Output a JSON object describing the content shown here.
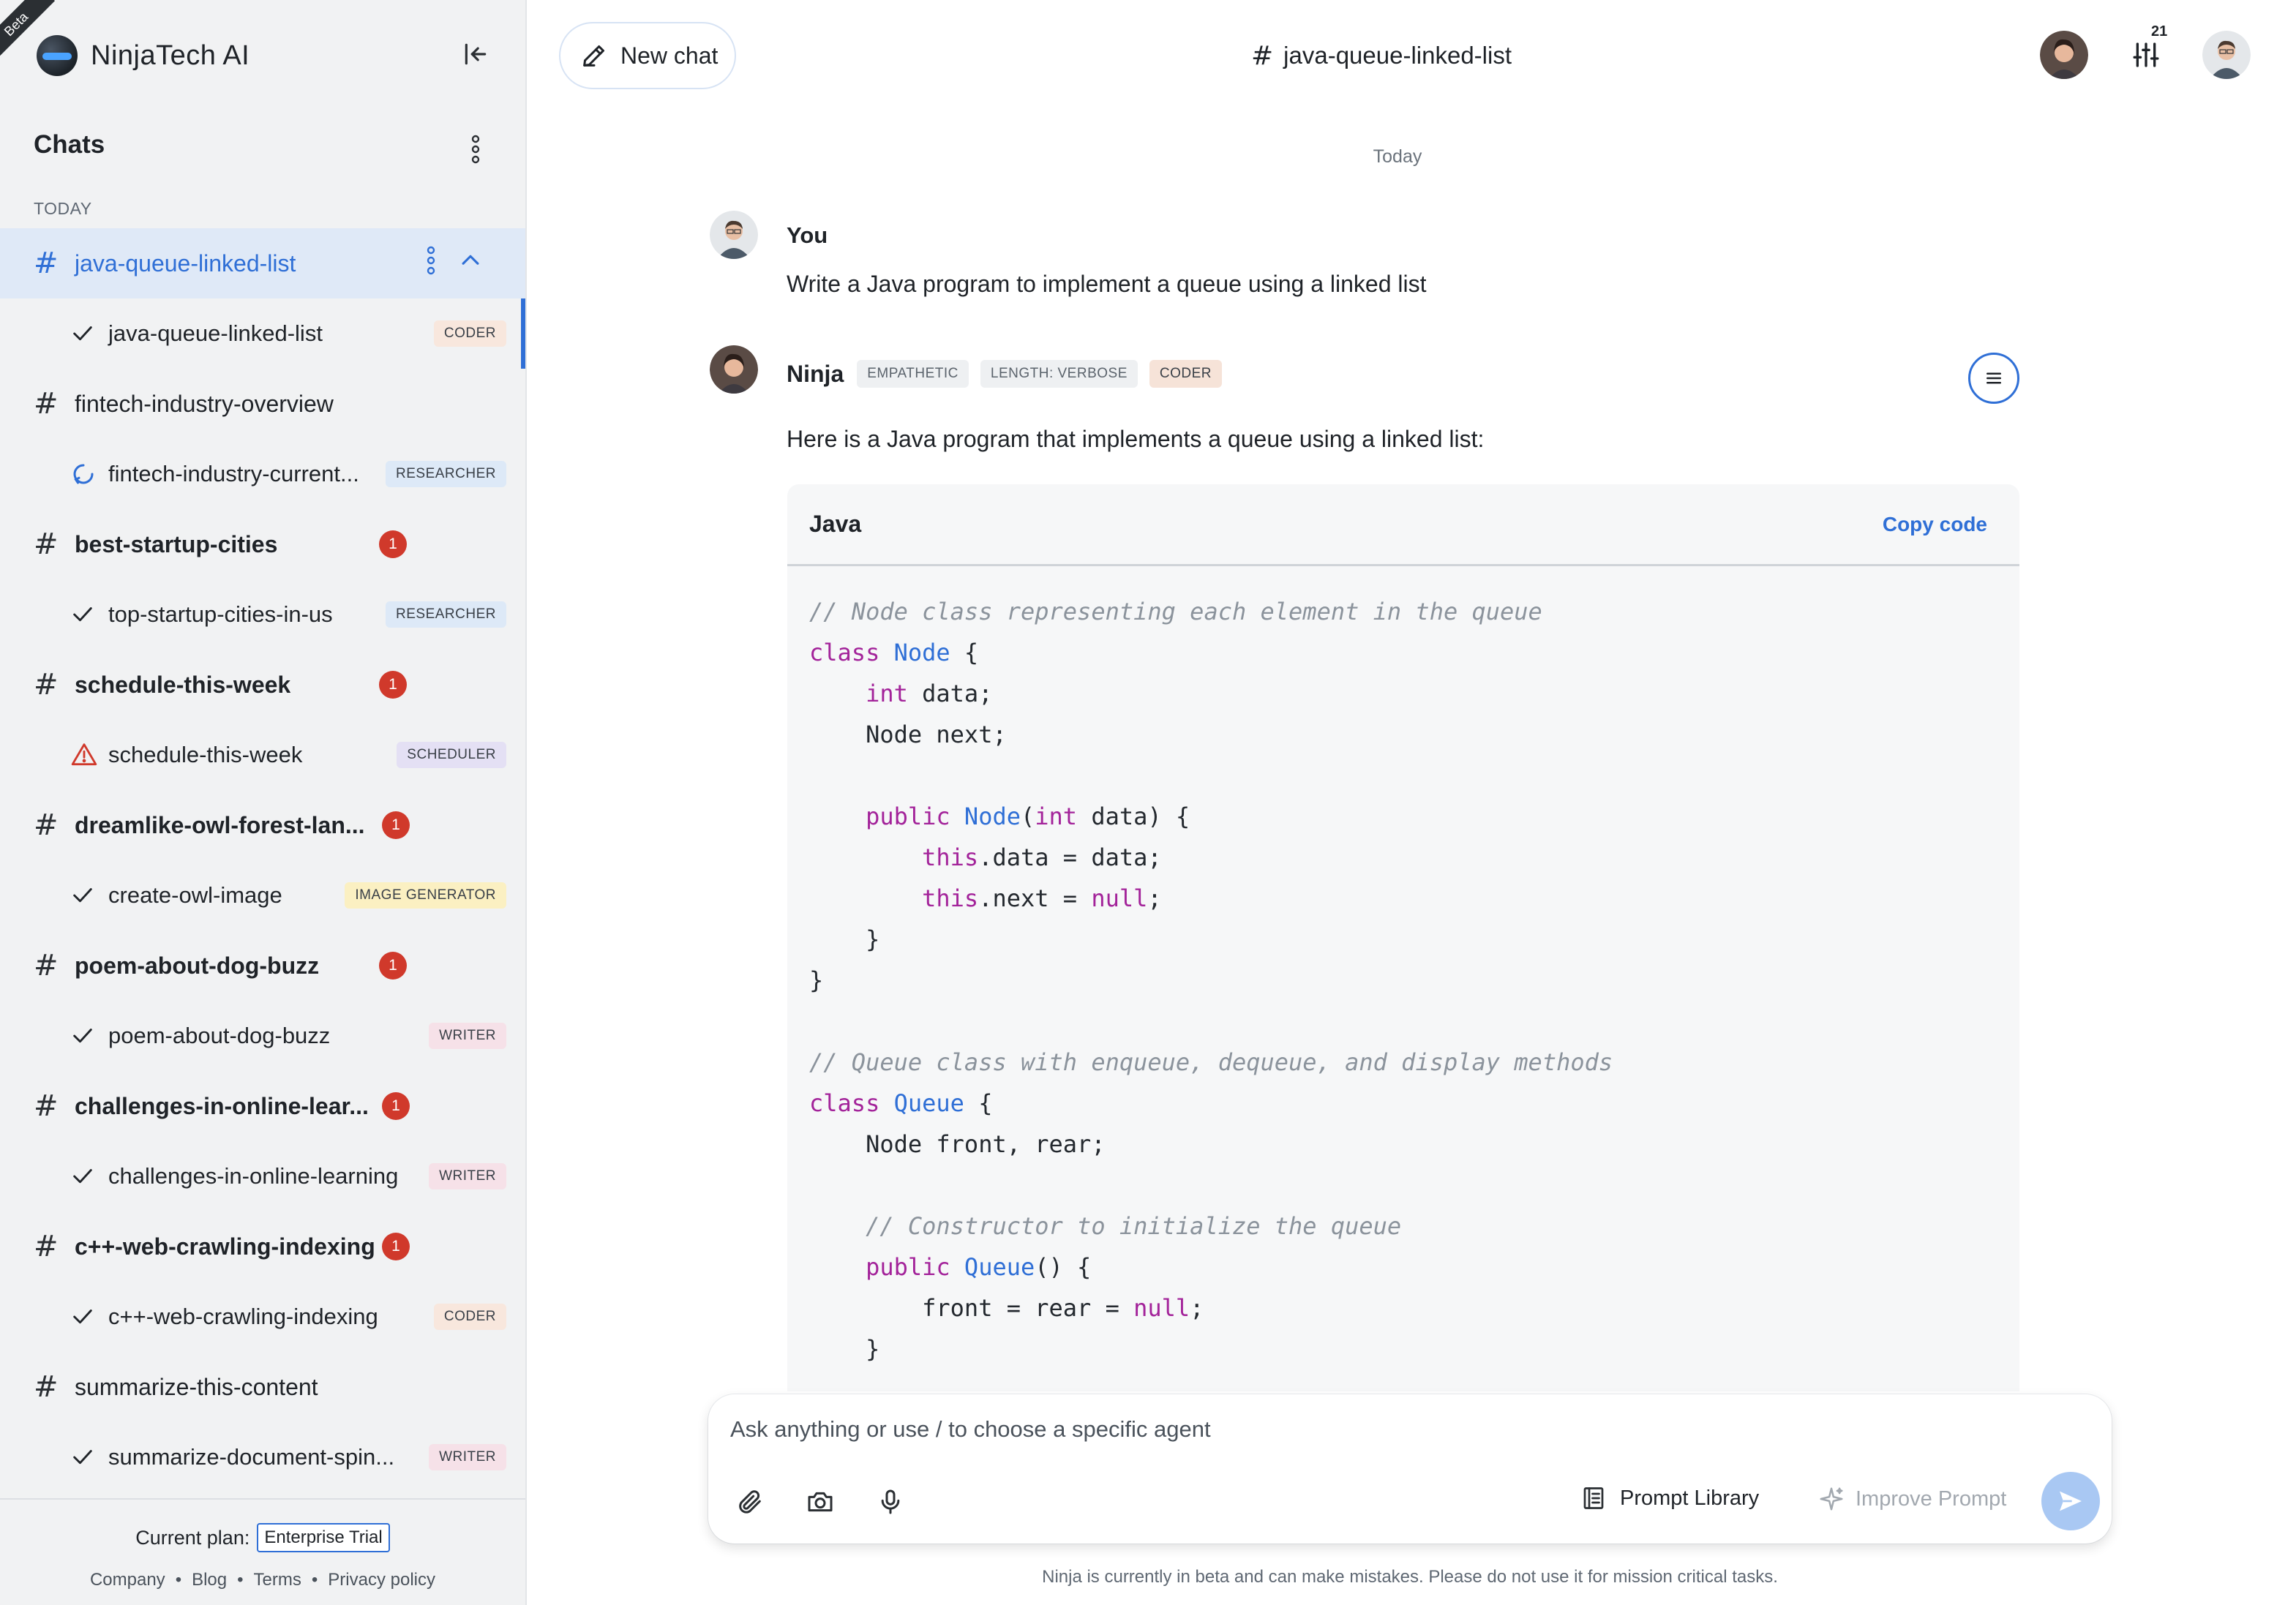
{
  "beta_ribbon": "Beta",
  "brand": {
    "name": "NinjaTech AI"
  },
  "sidebar": {
    "chats_title": "Chats",
    "section_label": "TODAY",
    "threads": [
      {
        "name": "java-queue-linked-list",
        "active": true,
        "bold": false,
        "unread": "",
        "task": {
          "name": "java-queue-linked-list",
          "status": "done",
          "agent": "CODER"
        }
      },
      {
        "name": "fintech-industry-overview",
        "active": false,
        "bold": false,
        "unread": "",
        "task": {
          "name": "fintech-industry-current...",
          "status": "in-progress",
          "agent": "RESEARCHER"
        }
      },
      {
        "name": "best-startup-cities",
        "active": false,
        "bold": true,
        "unread": "1",
        "task": {
          "name": "top-startup-cities-in-us",
          "status": "done",
          "agent": "RESEARCHER"
        }
      },
      {
        "name": "schedule-this-week",
        "active": false,
        "bold": true,
        "unread": "1",
        "task": {
          "name": "schedule-this-week",
          "status": "warning",
          "agent": "SCHEDULER"
        }
      },
      {
        "name": "dreamlike-owl-forest-lan...",
        "active": false,
        "bold": true,
        "unread": "1",
        "task": {
          "name": "create-owl-image",
          "status": "done",
          "agent": "IMAGE GENERATOR"
        }
      },
      {
        "name": "poem-about-dog-buzz",
        "active": false,
        "bold": true,
        "unread": "1",
        "task": {
          "name": "poem-about-dog-buzz",
          "status": "done",
          "agent": "WRITER"
        }
      },
      {
        "name": "challenges-in-online-lear...",
        "active": false,
        "bold": true,
        "unread": "1",
        "task": {
          "name": "challenges-in-online-learning",
          "status": "done",
          "agent": "WRITER"
        }
      },
      {
        "name": "c++-web-crawling-indexing",
        "active": false,
        "bold": true,
        "unread": "1",
        "task": {
          "name": "c++-web-crawling-indexing",
          "status": "done",
          "agent": "CODER"
        }
      },
      {
        "name": "summarize-this-content",
        "active": false,
        "bold": false,
        "unread": "",
        "task": {
          "name": "summarize-document-spin...",
          "status": "done",
          "agent": "WRITER"
        }
      }
    ],
    "footer": {
      "plan_label": "Current plan:",
      "plan_value": "Enterprise Trial",
      "links": [
        "Company",
        "Blog",
        "Terms",
        "Privacy policy"
      ]
    }
  },
  "header": {
    "new_chat_label": "New chat",
    "chat_title": "java-queue-linked-list",
    "settings_count": "21"
  },
  "conversation": {
    "day_label": "Today",
    "user_message": {
      "author": "You",
      "text": "Write a Java program to implement a queue using a linked list"
    },
    "ninja_message": {
      "author": "Ninja",
      "tags": [
        "EMPATHETIC",
        "LENGTH: VERBOSE",
        "CODER"
      ],
      "intro": "Here is a Java program that implements a queue using a linked list:",
      "code_language": "Java",
      "copy_label": "Copy code",
      "code_lines": [
        "// Node class representing each element in the queue",
        "class Node {",
        "    int data;",
        "    Node next;",
        "",
        "    public Node(int data) {",
        "        this.data = data;",
        "        this.next = null;",
        "    }",
        "}",
        "",
        "// Queue class with enqueue, dequeue, and display methods",
        "class Queue {",
        "    Node front, rear;",
        "",
        "    // Constructor to initialize the queue",
        "    public Queue() {",
        "        front = rear = null;",
        "    }"
      ]
    }
  },
  "composer": {
    "placeholder": "Ask anything or use / to choose a specific agent",
    "prompt_library_label": "Prompt Library",
    "improve_prompt_label": "Improve Prompt"
  },
  "disclaimer": "Ninja is currently in beta and can make mistakes. Please do not use it for mission critical tasks.",
  "colors": {
    "accent": "#2f6fd6",
    "unread_badge": "#d0392b",
    "sidebar_bg": "#f1f2f3",
    "active_row_bg": "#dfe9f7",
    "send_button": "#a9c8f3"
  }
}
